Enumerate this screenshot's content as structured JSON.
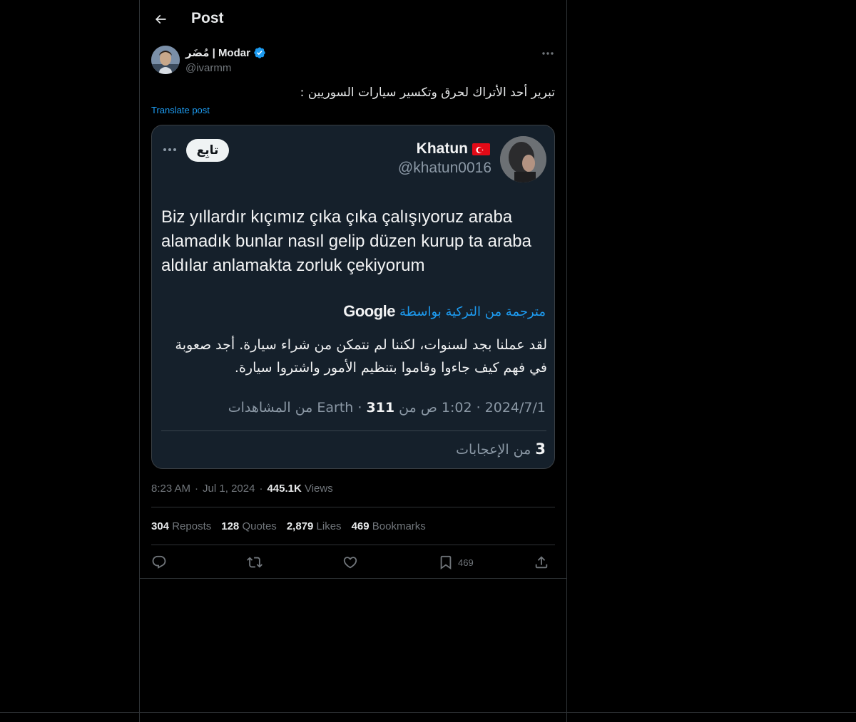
{
  "header": {
    "title": "Post"
  },
  "author": {
    "name": "مُضَر | Modar",
    "handle": "@ivarmm",
    "verified": true
  },
  "post": {
    "text": "تبرير أحد الأتراك لحرق وتكسير سيارات السوريين :",
    "translate_label": "Translate post"
  },
  "quoted": {
    "name": "Khatun",
    "handle": "@khatun0016",
    "follow_label": "تابِع",
    "text": "Biz yıllardır kıçımız çıka çıka çalışıyoruz araba alamadık bunlar nasıl gelip düzen kurup ta araba aldılar anlamakta zorluk çekiyorum",
    "translated_by_label": "مترجمة من التركية بواسطة",
    "google_label": "Google",
    "translation": "لقد عملنا بجد لسنوات، لكننا لم نتمكن من شراء سيارة. أجد صعوبة في فهم كيف جاءوا وقاموا بتنظيم الأمور واشتروا سيارة.",
    "meta_prefix": "2024/7/1 · 1:02 ص من Earth · ",
    "views_count": "311",
    "views_label": " من المشاهدات",
    "likes_count": "3",
    "likes_label": " من الإعجابات"
  },
  "meta": {
    "time": "8:23 AM",
    "date": "Jul 1, 2024",
    "views_count": "445.1K",
    "views_label": "Views"
  },
  "stats": {
    "reposts": {
      "count": "304",
      "label": "Reposts"
    },
    "quotes": {
      "count": "128",
      "label": "Quotes"
    },
    "likes": {
      "count": "2,879",
      "label": "Likes"
    },
    "bookmarks": {
      "count": "469",
      "label": "Bookmarks"
    }
  },
  "actions": {
    "bookmark_count": "469"
  },
  "colors": {
    "accent": "#1d9bf0",
    "background": "#000000",
    "quoted_bg": "#15202b"
  }
}
